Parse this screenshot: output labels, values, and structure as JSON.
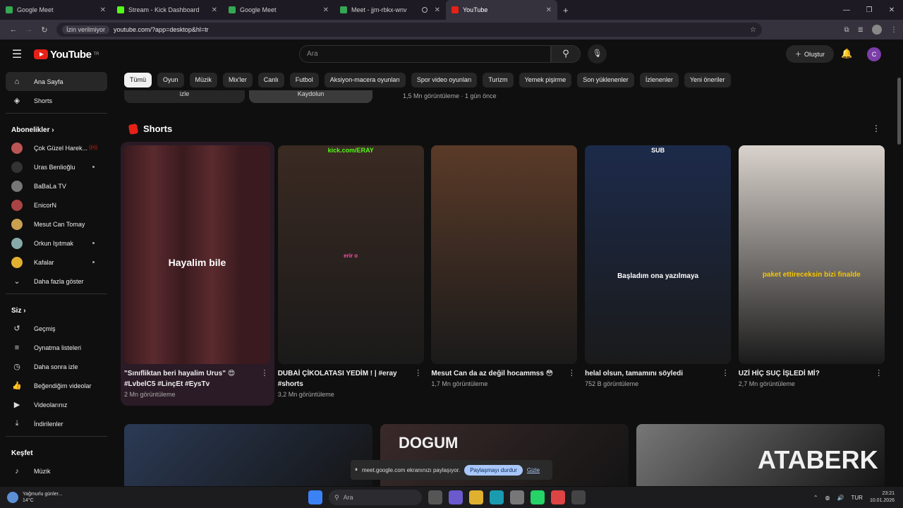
{
  "browser": {
    "tabs": [
      {
        "label": "Google Meet",
        "color": "#34a853",
        "active": false,
        "recording": false
      },
      {
        "label": "Stream - Kick Dashboard",
        "color": "#53fc18",
        "active": false,
        "recording": false
      },
      {
        "label": "Google Meet",
        "color": "#34a853",
        "active": false,
        "recording": false
      },
      {
        "label": "Meet - jjm-rbkx-wnv",
        "color": "#34a853",
        "active": false,
        "recording": true
      },
      {
        "label": "YouTube",
        "color": "#e62117",
        "active": true,
        "recording": false
      }
    ],
    "new_tab": "+",
    "permission": "İzin verilmiyor",
    "url": "youtube.com/?app=desktop&hl=tr"
  },
  "youtube": {
    "logo_word": "YouTube",
    "logo_region": "TR",
    "search_placeholder": "Ara",
    "create_label": "Oluştur",
    "avatar_initial": "C",
    "accent": "#e62117"
  },
  "sidebar": {
    "main": [
      {
        "label": "Ana Sayfa",
        "icon": "home-icon",
        "glyph": "⌂",
        "active": true
      },
      {
        "label": "Shorts",
        "icon": "shorts-icon",
        "glyph": "◈",
        "active": false
      }
    ],
    "subs_title": "Abonelikler",
    "subs": [
      {
        "label": "Çok Güzel Harek...",
        "color": "#b55",
        "badge": "live"
      },
      {
        "label": "Uras Benlioğlu",
        "color": "#333",
        "badge": "dot"
      },
      {
        "label": "BaBaLa TV",
        "color": "#777",
        "badge": ""
      },
      {
        "label": "EnicorN",
        "color": "#a44",
        "badge": ""
      },
      {
        "label": "Mesut Can Tomay",
        "color": "#c8a050",
        "badge": ""
      },
      {
        "label": "Orkun Işıtmak",
        "color": "#8aa",
        "badge": "dot"
      },
      {
        "label": "Kafalar",
        "color": "#e0b030",
        "badge": "dot"
      }
    ],
    "more_label": "Daha fazla göster",
    "you_title": "Siz",
    "you": [
      {
        "label": "Geçmiş",
        "icon": "history-icon",
        "glyph": "↺"
      },
      {
        "label": "Oynatma listeleri",
        "icon": "playlist-icon",
        "glyph": "≡"
      },
      {
        "label": "Daha sonra izle",
        "icon": "clock-icon",
        "glyph": "◷"
      },
      {
        "label": "Beğendiğim videolar",
        "icon": "thumbs-up-icon",
        "glyph": "👍"
      },
      {
        "label": "Videolarınız",
        "icon": "video-icon",
        "glyph": "▶"
      },
      {
        "label": "İndirilenler",
        "icon": "download-icon",
        "glyph": "⤓"
      }
    ],
    "explore_title": "Keşfet",
    "explore": [
      {
        "label": "Müzik",
        "icon": "music-icon",
        "glyph": "♪"
      }
    ]
  },
  "chips": [
    "Tümü",
    "Oyun",
    "Müzik",
    "Mix'ler",
    "Canlı",
    "Futbol",
    "Aksiyon-macera oyunları",
    "Spor video oyunları",
    "Turizm",
    "Yemek pişirme",
    "Son yüklenenler",
    "İzlenenler",
    "Yeni öneriler"
  ],
  "prev_row": {
    "btn1": "izle",
    "btn2": "Kaydolun",
    "meta": "1,5 Mn görüntüleme · 1 gün önce"
  },
  "shorts_title": "Shorts",
  "shorts": [
    {
      "title": "\"Sınıfliktan beri hayalim Urus\" 😍 #LvbelC5 #LinçEt #EysTv",
      "views": "2 Mn görüntüleme",
      "caption": "Hayalim bile",
      "bg": "#4a2a2e"
    },
    {
      "title": "DUBAİ ÇİKOLATASI YEDİM ! | #eray #shorts",
      "views": "3,2 Mn görüntüleme",
      "caption": "erir o",
      "overlay": "kick.com/ERAY",
      "bg": "#3a2a22"
    },
    {
      "title": "Mesut Can da az değil hocammss 😳",
      "views": "1,7 Mn görüntüleme",
      "caption": "",
      "bg": "#5a3a28"
    },
    {
      "title": "helal olsun, tamamını söyledi",
      "views": "752 B görüntüleme",
      "caption": "Başladım ona yazılmaya",
      "overlay": "SUB",
      "bg": "#1c2a4a"
    },
    {
      "title": "UZİ HİÇ SUÇ İŞLEDİ Mİ?",
      "views": "2,7 Mn görüntüleme",
      "caption": "paket ettireceksin bizi finalde",
      "bg": "#d9d2cc"
    }
  ],
  "row2": [
    {
      "text": "",
      "bg": "#2b3a55"
    },
    {
      "text": "DOGUM",
      "bg": "#3a2a2a"
    },
    {
      "text": "ATABERK",
      "bg": "#777777"
    }
  ],
  "share_banner": {
    "text": "meet.google.com ekranınızı paylaşıyor.",
    "stop": "Paylaşmayı durdur",
    "hide": "Gizle"
  },
  "taskbar": {
    "weather_title": "Yağmurlu günler...",
    "weather_temp": "14°C",
    "search_label": "Ara",
    "lang": "TUR",
    "time": "23:21",
    "date": "10.01.2026"
  }
}
